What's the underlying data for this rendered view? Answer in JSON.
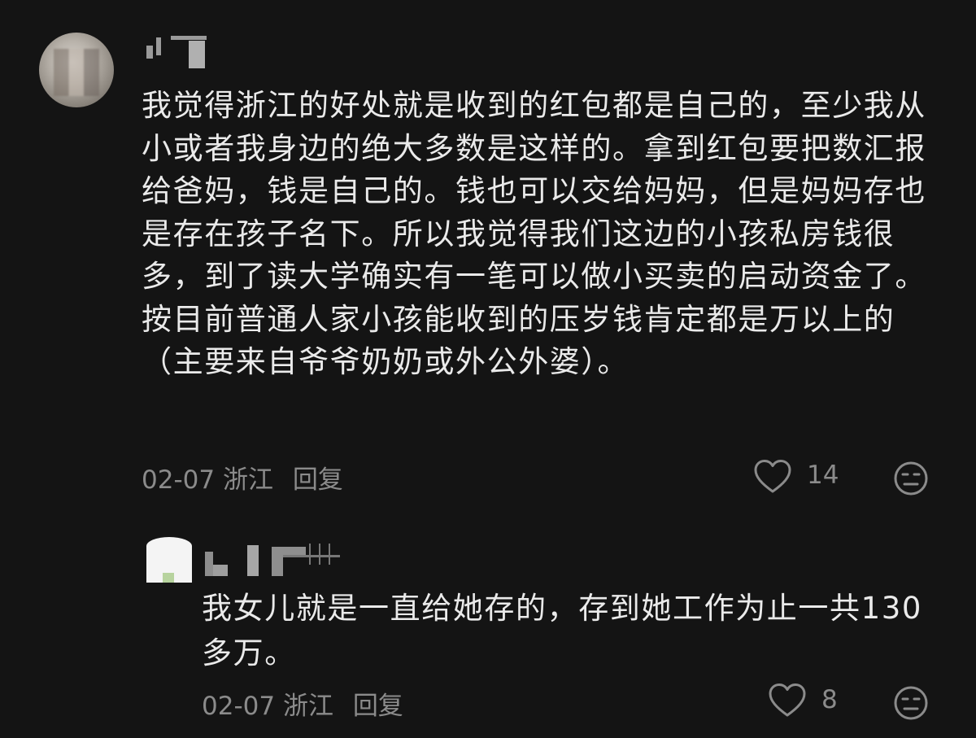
{
  "comment": {
    "body": "我觉得浙江的好处就是收到的红包都是自己的，至少我从小或者我身边的绝大多数是这样的。拿到红包要把数汇报给爸妈，钱是自己的。钱也可以交给妈妈，但是妈妈存也是存在孩子名下。所以我觉得我们这边的小孩私房钱很多，到了读大学确实有一笔可以做小买卖的启动资金了。按目前普通人家小孩能收到的压岁钱肯定都是万以上的（主要来自爷爷奶奶或外公外婆）。",
    "date": "02-07",
    "location": "浙江",
    "reply_label": "回复",
    "like_count": "14"
  },
  "reply": {
    "body": "我女儿就是一直给她存的，存到她工作为止一共130多万。",
    "date": "02-07",
    "location": "浙江",
    "reply_label": "回复",
    "like_count": "8"
  },
  "icons": {
    "like": "heart-icon",
    "emoji": "meh-face-icon"
  },
  "colors": {
    "background": "#141414",
    "text": "#eaeaea",
    "meta": "#8b8b8b"
  }
}
